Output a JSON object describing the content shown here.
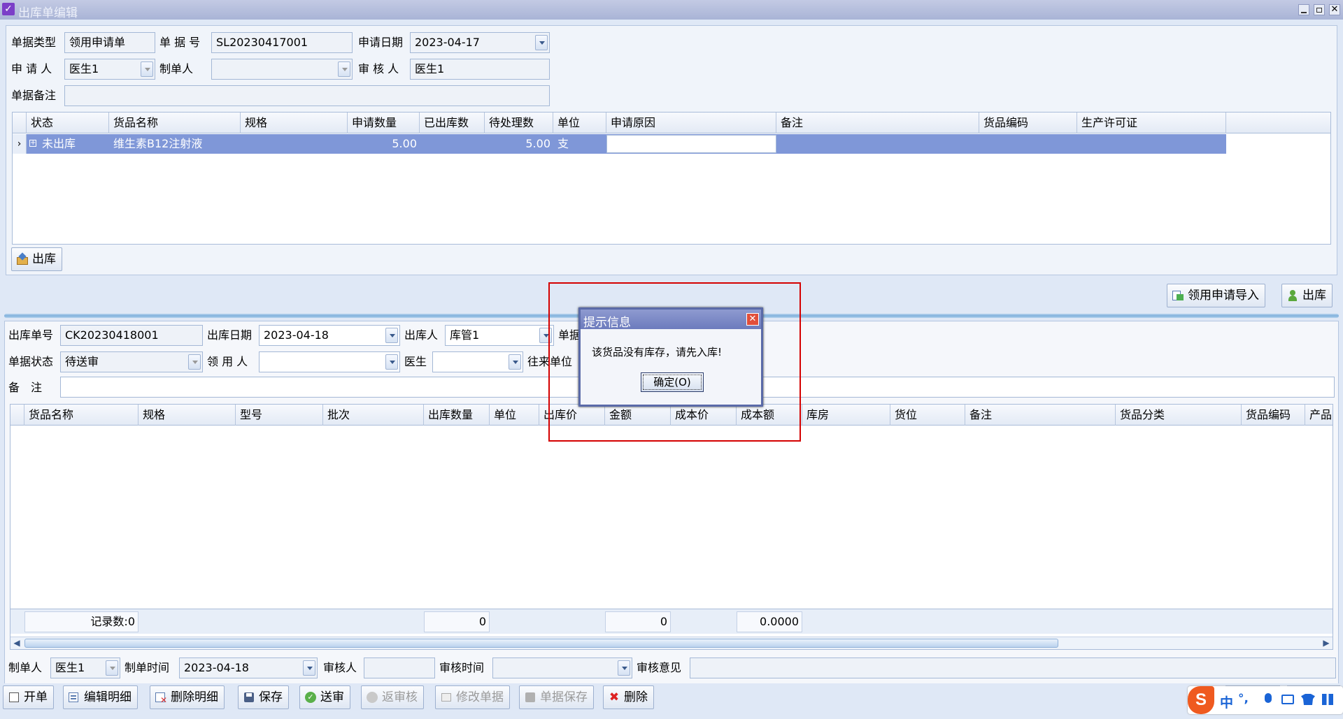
{
  "window": {
    "title": "出库单编辑"
  },
  "top_form": {
    "doc_type_label": "单据类型",
    "doc_type_value": "领用申请单",
    "doc_no_label": "单 据 号",
    "doc_no_value": "SL20230417001",
    "apply_date_label": "申请日期",
    "apply_date_value": "2023-04-17",
    "applicant_label": "申 请 人",
    "applicant_value": "医生1",
    "maker_label": "制单人",
    "maker_value": "",
    "reviewer_label": "审 核 人",
    "reviewer_value": "医生1",
    "remark_label": "单据备注",
    "remark_value": ""
  },
  "top_grid": {
    "headers": [
      "状态",
      "货品名称",
      "规格",
      "申请数量",
      "已出库数",
      "待处理数",
      "单位",
      "申请原因",
      "备注",
      "货品编码",
      "生产许可证"
    ],
    "rows": [
      {
        "status": "未出库",
        "name": "维生素B12注射液",
        "spec": "",
        "apply_qty": "5.00",
        "out_qty": "",
        "pending_qty": "5.00",
        "unit": "支",
        "reason": "",
        "remark": "",
        "code": "",
        "license": ""
      }
    ]
  },
  "top_out_button": "出库",
  "right_buttons": {
    "import": "领用申请导入",
    "out": "出库"
  },
  "bottom_form": {
    "out_no_label": "出库单号",
    "out_no_value": "CK20230418001",
    "out_date_label": "出库日期",
    "out_date_value": "2023-04-18",
    "out_person_label": "出库人",
    "out_person_value": "库管1",
    "doc_label_partial": "单据",
    "doc_status_label": "单据状态",
    "doc_status_value": "待送审",
    "receiver_label": "领 用 人",
    "receiver_value": "",
    "doctor_label": "医生",
    "doctor_value": "",
    "partner_label": "往来单位",
    "remark_label": "备　注",
    "remark_value": ""
  },
  "bottom_grid": {
    "headers": [
      "货品名称",
      "规格",
      "型号",
      "批次",
      "出库数量",
      "单位",
      "出库价",
      "金额",
      "成本价",
      "成本额",
      "库房",
      "货位",
      "备注",
      "货品分类",
      "货品编码",
      "产品"
    ],
    "summary": {
      "record_count": "记录数:0",
      "qty_total": "0",
      "amount_total": "0",
      "cost_total": "0.0000"
    }
  },
  "footer_form": {
    "maker_label": "制单人",
    "maker_value": "医生1",
    "make_time_label": "制单时间",
    "make_time_value": "2023-04-18",
    "reviewer_label": "审核人",
    "reviewer_value": "",
    "review_time_label": "审核时间",
    "review_time_value": "",
    "review_opinion_label": "审核意见",
    "review_opinion_value": ""
  },
  "toolbar": {
    "open": "开单",
    "edit_detail": "编辑明细",
    "delete_detail": "删除明细",
    "save": "保存",
    "submit": "送审",
    "unreview": "返审核",
    "modify": "修改单据",
    "doc_save": "单据保存",
    "delete": "删除"
  },
  "dialog": {
    "title": "提示信息",
    "message": "该货品没有库存，请先入库!",
    "ok_button": "确定(O)"
  },
  "ime": {
    "mode": "中",
    "punct": "°,"
  },
  "colors": {
    "title_bar": "#a9b4d6",
    "selected_row": "#7f97d8",
    "dialog_border": "#5a6aa8",
    "highlight_box": "#d40000"
  }
}
